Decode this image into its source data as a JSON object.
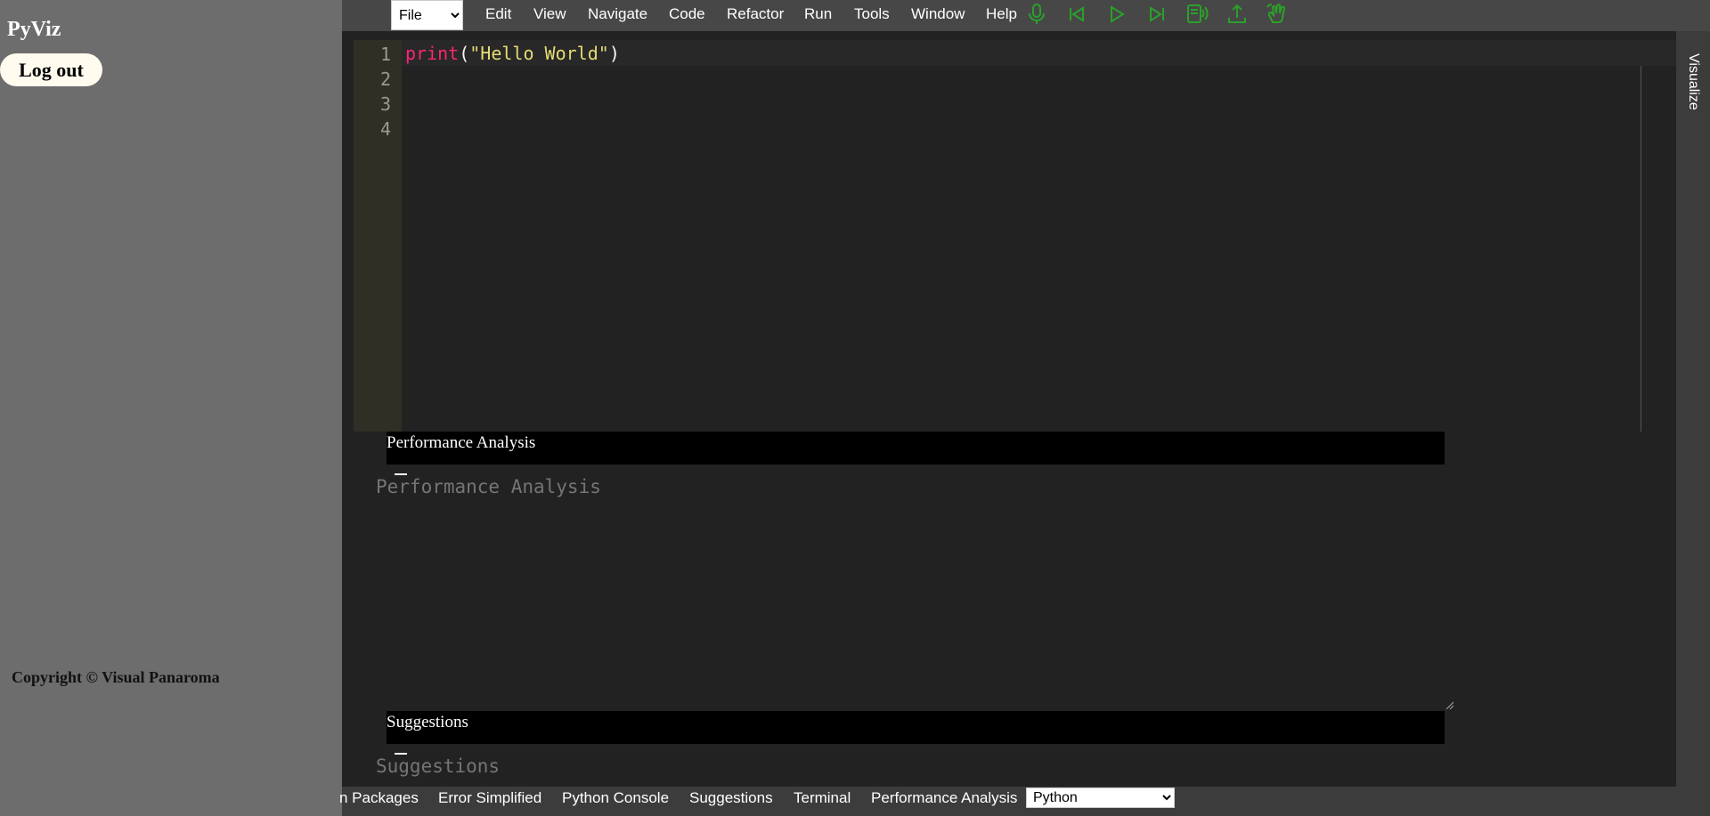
{
  "sidebar": {
    "brand": "PyViz",
    "logout_label": "Log out",
    "copyright": "Copyright © Visual Panaroma"
  },
  "menubar": {
    "file_select": "File",
    "items": [
      "Edit",
      "View",
      "Navigate",
      "Code",
      "Refactor",
      "Run",
      "Tools",
      "Window",
      "Help"
    ],
    "icons": [
      "microphone-icon",
      "skip-back-icon",
      "play-icon",
      "skip-forward-icon",
      "voice-assist-icon",
      "upload-icon",
      "gesture-icon"
    ],
    "icon_color": "#2aa02a"
  },
  "editor": {
    "line_numbers": [
      "1",
      "2",
      "3",
      "4"
    ],
    "code": {
      "fn": "print",
      "open": "(",
      "str": "\"Hello World\"",
      "close": ")"
    }
  },
  "right_tab": "Visualize",
  "panels": {
    "performance": {
      "header": "Performance Analysis",
      "placeholder": "Performance Analysis"
    },
    "suggestions": {
      "header": "Suggestions",
      "placeholder": "Suggestions"
    }
  },
  "bottom_tabs": [
    "n Packages",
    "Error Simplified",
    "Python Console",
    "Suggestions",
    "Terminal",
    "Performance Analysis"
  ],
  "language_select": "Python"
}
